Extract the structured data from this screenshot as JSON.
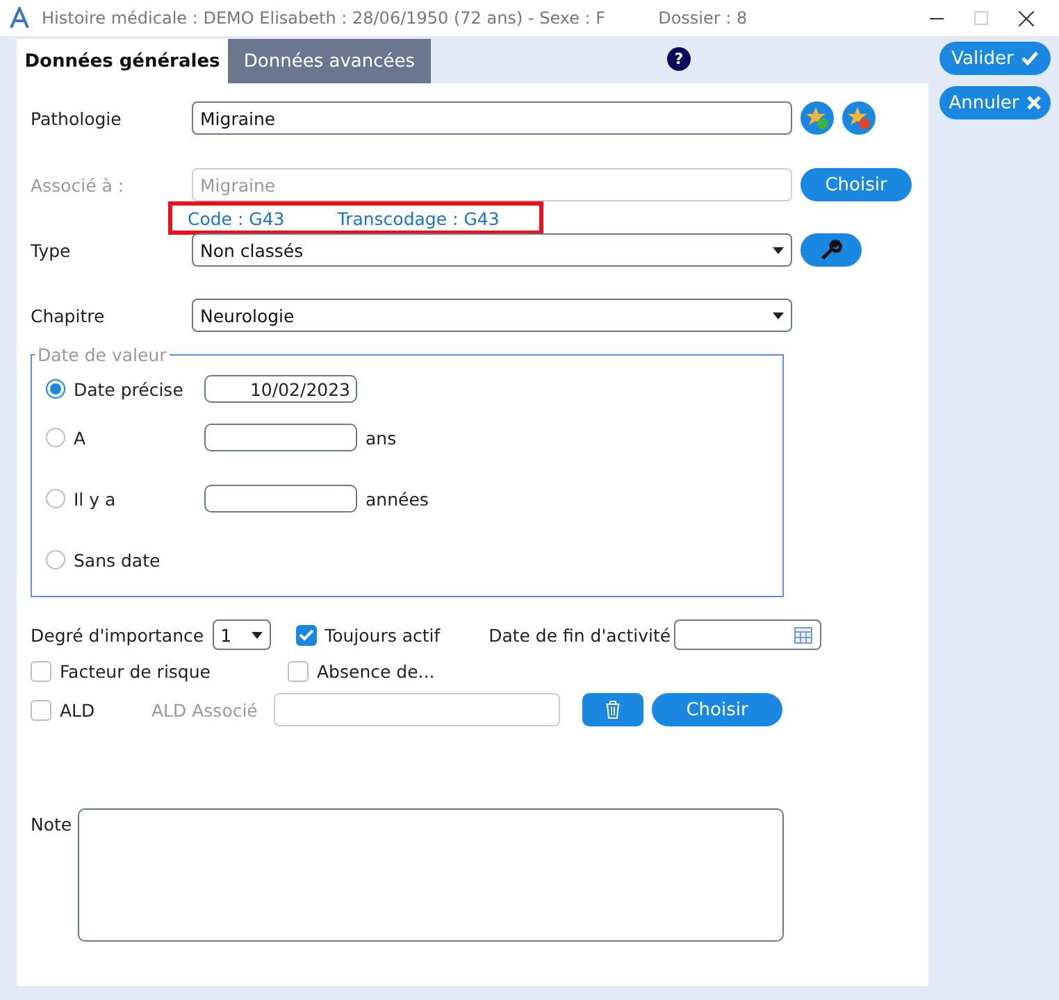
{
  "window": {
    "title": "Histoire médicale : DEMO Elisabeth : 28/06/1950 (72 ans) - Sexe : F",
    "dossier": "Dossier : 8"
  },
  "tabs": [
    {
      "label": "Données générales",
      "selected": true
    },
    {
      "label": "Données avancées",
      "selected": false
    }
  ],
  "help": "?",
  "side_buttons": [
    "Valider",
    "Annuler"
  ],
  "pathologie": {
    "label": "Pathologie",
    "value": "Migraine"
  },
  "associe": {
    "label": "Associé à :",
    "value": "Migraine",
    "disabled": true,
    "button": "Choisir",
    "code": "Code : G43",
    "transcodage": "Transcodage : G43"
  },
  "type": {
    "label": "Type",
    "value": "Non classés"
  },
  "chapitre": {
    "label": "Chapitre",
    "value": "Neurologie"
  },
  "date_de_valeur": {
    "legend": "Date de valeur",
    "options": [
      {
        "kind": "date",
        "label": "Date précise",
        "selected": true,
        "value": "10/02/2023"
      },
      {
        "kind": "unit",
        "label": "A",
        "selected": false,
        "unit": "ans"
      },
      {
        "kind": "unit",
        "label": "Il y a",
        "selected": false,
        "unit": "années"
      },
      {
        "kind": "none",
        "label": "Sans date",
        "selected": false
      }
    ]
  },
  "importance": {
    "label": "Degré d'importance",
    "value": "1"
  },
  "toujours_actif": {
    "label": "Toujours actif",
    "checked": true
  },
  "fin_activite": {
    "label": "Date de fin d'activité"
  },
  "facteur_risque": {
    "label": "Facteur de risque",
    "checked": false
  },
  "absence": {
    "label": "Absence de...",
    "checked": false
  },
  "ald": {
    "label": "ALD",
    "checked": false,
    "associe_label": "ALD Associé",
    "button": "Choisir"
  },
  "note": {
    "label": "Note"
  }
}
